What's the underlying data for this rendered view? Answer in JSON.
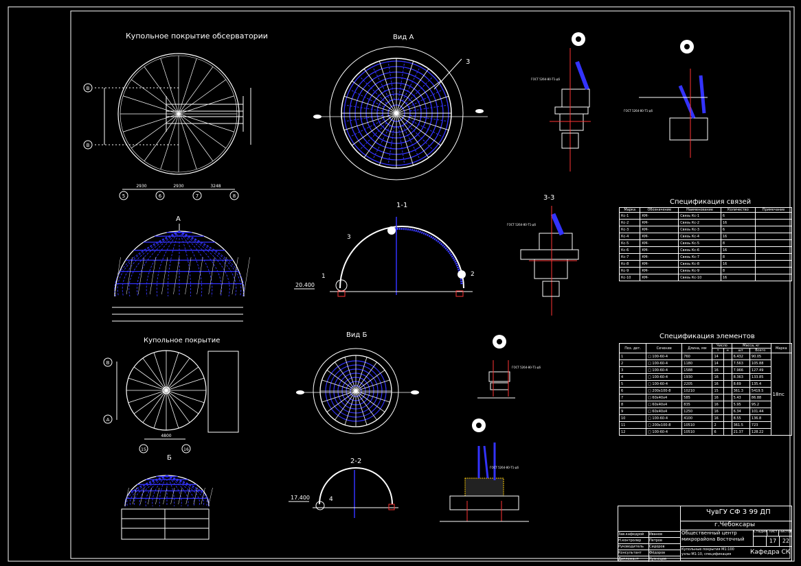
{
  "views": {
    "observatory_title": "Купольное покрытие обсерватории",
    "dome_title": "Купольное покрытие",
    "view_a": "Вид А",
    "view_b": "Вид Б",
    "sec_11": "1-1",
    "sec_22": "2-2",
    "sec_33": "3-3",
    "arrow_a": "А",
    "arrow_b": "Б",
    "elev_1": "20.400",
    "elev_2": "17.400",
    "marker_3": "3"
  },
  "axes_top": {
    "left": [
      "B",
      "B"
    ],
    "bottom": [
      "5",
      "6",
      "7",
      "8"
    ],
    "dims": [
      "2930",
      "2930",
      "3248"
    ]
  },
  "axes_bottom": {
    "left": [
      "B",
      "A"
    ],
    "bottom": [
      "15",
      "16"
    ],
    "dim": "4800"
  },
  "callouts": [
    "1",
    "2",
    "3",
    "4"
  ],
  "gost_label": "ГОСТ 5264-80-Т1-д6",
  "spec_links": {
    "title": "Спецификация связей",
    "headers": [
      "Марка",
      "Обозначение",
      "Наименование",
      "Количество",
      "Примечание"
    ],
    "rows": [
      [
        "Кс-1",
        "КМ-",
        "Связь Кс-1",
        "6",
        ""
      ],
      [
        "Кс-2",
        "КМ-",
        "Связь Кс-2",
        "16",
        ""
      ],
      [
        "Кс-3",
        "КМ-",
        "Связь Кс-3",
        "6",
        ""
      ],
      [
        "Кс-4",
        "КМ-",
        "Связь Кс-4",
        "16",
        ""
      ],
      [
        "Кс-5",
        "КМ-",
        "Связь Кс-5",
        "8",
        ""
      ],
      [
        "Кс-6",
        "КМ-",
        "Связь Кс-6",
        "16",
        ""
      ],
      [
        "Кс-7",
        "КМ-",
        "Связь Кс-7",
        "8",
        ""
      ],
      [
        "Кс-8",
        "КМ-",
        "Связь Кс-8",
        "16",
        ""
      ],
      [
        "Кс-9",
        "КМ-",
        "Связь Кс-9",
        "8",
        ""
      ],
      [
        "Кс-10",
        "КМ-",
        "Связь Кс-10",
        "16",
        ""
      ]
    ]
  },
  "spec_elements": {
    "title": "Спецификация элементов",
    "headers": [
      "Поз. дет.",
      "Сечение",
      "Длина, мм",
      "Число",
      "Масса, кг",
      "Марка"
    ],
    "subheaders": [
      "т",
      "н",
      "шт",
      "Всего"
    ],
    "note": "18пс",
    "rows": [
      [
        "1",
        "□ 100-60-4",
        "760",
        "14",
        "6.432",
        "90.05"
      ],
      [
        "2",
        "□ 100-60-4",
        "1180",
        "14",
        "7.563",
        "105.88"
      ],
      [
        "3",
        "□ 100-60-4",
        "1588",
        "16",
        "7.966",
        "127.49"
      ],
      [
        "4",
        "□ 100-60-4",
        "1930",
        "16",
        "8.363",
        "133.85"
      ],
      [
        "5",
        "□ 100-60-4",
        "2205",
        "16",
        "8.69",
        "135.4"
      ],
      [
        "6",
        "□ 200х100-8",
        "10210",
        "15",
        "361.3",
        "5419.5"
      ],
      [
        "7",
        "□ 60х40х4",
        "585",
        "16",
        "5.43",
        "86.88"
      ],
      [
        "8",
        "□ 60х40х4",
        "835",
        "16",
        "5.95",
        "95.2"
      ],
      [
        "9",
        "□ 60х40х4",
        "1250",
        "16",
        "6.34",
        "101.44"
      ],
      [
        "10",
        "□ 100-60-4",
        "4100",
        "16",
        "8.55",
        "136.8"
      ],
      [
        "11",
        "□ 200х100-8",
        "10510",
        "2",
        "361.5",
        "723"
      ],
      [
        "12",
        "□ 100-60-4",
        "10510",
        "6",
        "21.37",
        "128.22"
      ]
    ]
  },
  "title_block": {
    "code": "ЧувГУ СФ 3 99 ДП",
    "city": "г.Чебоксары",
    "project_line1": "Общественный центр",
    "project_line2": "микрорайона Восточный",
    "sheet_headers": [
      "Стадия",
      "Лист",
      "Листов"
    ],
    "sheet_values": [
      "",
      "17",
      "22"
    ],
    "drawing_line1": "Купольные покрытия М1:100",
    "drawing_line2": "узлы М1:10, спецификация",
    "department": "Кафедра СК",
    "roles": [
      "Зав.кафедрой",
      "Н.контролер",
      "Руководитель",
      "Консультант",
      "Дипломант"
    ],
    "names": [
      "Иванов",
      "Петров",
      "Сидоров",
      "Фёдоров",
      "Кузнецов"
    ]
  }
}
